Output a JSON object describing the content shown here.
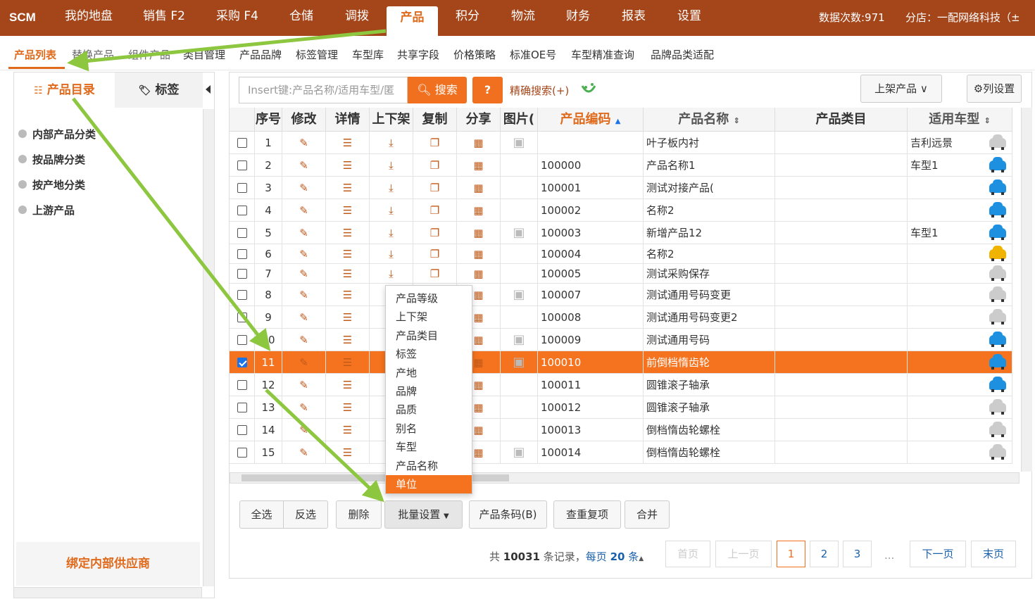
{
  "topnav": {
    "logo": "SCM",
    "items": [
      "我的地盘",
      "销售 F2",
      "采购 F4",
      "仓储",
      "调拨",
      "产品",
      "积分",
      "物流",
      "财务",
      "报表",
      "设置"
    ],
    "active": "产品",
    "data_count": "数据次数:971",
    "branch": "分店：一配网络科技（±"
  },
  "subnav": {
    "items": [
      "产品列表",
      "替换产品",
      "组件产品",
      "类目管理",
      "产品品牌",
      "标签管理",
      "车型库",
      "共享字段",
      "价格策略",
      "标准OE号",
      "车型精准查询",
      "品牌品类适配"
    ],
    "active": "产品列表"
  },
  "left": {
    "tab_catalog": "产品目录",
    "tab_tags": "标签",
    "tree": [
      "内部产品分类",
      "按品牌分类",
      "按产地分类",
      "上游产品"
    ],
    "bind_supplier": "绑定内部供应商"
  },
  "toolbar": {
    "search_placeholder": "Insert键:产品名称/适用车型/匿",
    "search_label": "搜索",
    "help_label": "?",
    "exact_search": "精确搜索(+)",
    "shelf_filter": "上架产品",
    "column_settings": "列设置"
  },
  "grid": {
    "headers": [
      "",
      "序号",
      "修改",
      "详情",
      "上下架",
      "复制",
      "分享",
      "图片(",
      "产品编码",
      "产品名称",
      "产品类目",
      "适用车型"
    ],
    "rows": [
      {
        "no": "1",
        "code": "",
        "name": "叶子板内衬",
        "model": "吉利远景",
        "img": true,
        "car": "#ccc",
        "checked": false
      },
      {
        "no": "2",
        "code": "100000",
        "name": "产品名称1",
        "model": "车型1",
        "img": false,
        "car": "#1e90e0",
        "checked": false
      },
      {
        "no": "3",
        "code": "100001",
        "name": "测试对接产品(",
        "model": "",
        "img": false,
        "car": "#1e90e0",
        "checked": false
      },
      {
        "no": "4",
        "code": "100002",
        "name": "名称2",
        "model": "",
        "img": false,
        "car": "#1e90e0",
        "checked": false
      },
      {
        "no": "5",
        "code": "100003",
        "name": "新增产品12",
        "model": "车型1",
        "img": true,
        "car": "#1e90e0",
        "checked": false
      },
      {
        "no": "6",
        "code": "100004",
        "name": "名称2",
        "model": "",
        "img": false,
        "car": "#f0b400",
        "checked": false
      },
      {
        "no": "7",
        "code": "100005",
        "name": "测试采购保存",
        "model": "",
        "img": false,
        "car": "#ccc",
        "checked": false
      },
      {
        "no": "8",
        "code": "100007",
        "name": "测试通用号码变更",
        "model": "",
        "img": true,
        "car": "#ccc",
        "checked": false
      },
      {
        "no": "9",
        "code": "100008",
        "name": "测试通用号码变更2",
        "model": "",
        "img": false,
        "car": "#ccc",
        "checked": false
      },
      {
        "no": "10",
        "code": "100009",
        "name": "测试通用号码",
        "model": "",
        "img": true,
        "car": "#1e90e0",
        "checked": false
      },
      {
        "no": "11",
        "code": "100010",
        "name": "前倒档惰齿轮",
        "model": "",
        "img": true,
        "car": "#1e90e0",
        "checked": true
      },
      {
        "no": "12",
        "code": "100011",
        "name": "圆锥滚子轴承",
        "model": "",
        "img": false,
        "car": "#1e90e0",
        "checked": false
      },
      {
        "no": "13",
        "code": "100012",
        "name": "圆锥滚子轴承",
        "model": "",
        "img": false,
        "car": "#ccc",
        "checked": false
      },
      {
        "no": "14",
        "code": "100013",
        "name": "倒档惰齿轮螺栓",
        "model": "",
        "img": false,
        "car": "#ccc",
        "checked": false
      },
      {
        "no": "15",
        "code": "100014",
        "name": "倒档惰齿轮螺栓",
        "model": "",
        "img": true,
        "car": "#ccc",
        "checked": false
      }
    ]
  },
  "dropdown": {
    "items": [
      "产品等级",
      "上下架",
      "产品类目",
      "标签",
      "产地",
      "品牌",
      "品质",
      "别名",
      "车型",
      "产品名称",
      "单位"
    ],
    "active": "单位"
  },
  "actions": {
    "select_all": "全选",
    "invert": "反选",
    "delete": "删除",
    "batch": "批量设置",
    "barcode": "产品条码(B)",
    "dedupe": "查重复项",
    "merge": "合并"
  },
  "pagination": {
    "total_prefix": "共",
    "total": "10031",
    "total_suffix": "条记录，",
    "per_page_prefix": "每页",
    "per_page": "20",
    "per_page_suffix": "条",
    "first": "首页",
    "prev": "上一页",
    "pages": [
      "1",
      "2",
      "3"
    ],
    "ellipsis": "...",
    "next": "下一页",
    "last": "末页",
    "current": "1"
  },
  "colors": {
    "brand": "#a5461a",
    "accent": "#f07020",
    "selected_row": "#f5731f",
    "annotation_arrow": "#8dc63f"
  }
}
